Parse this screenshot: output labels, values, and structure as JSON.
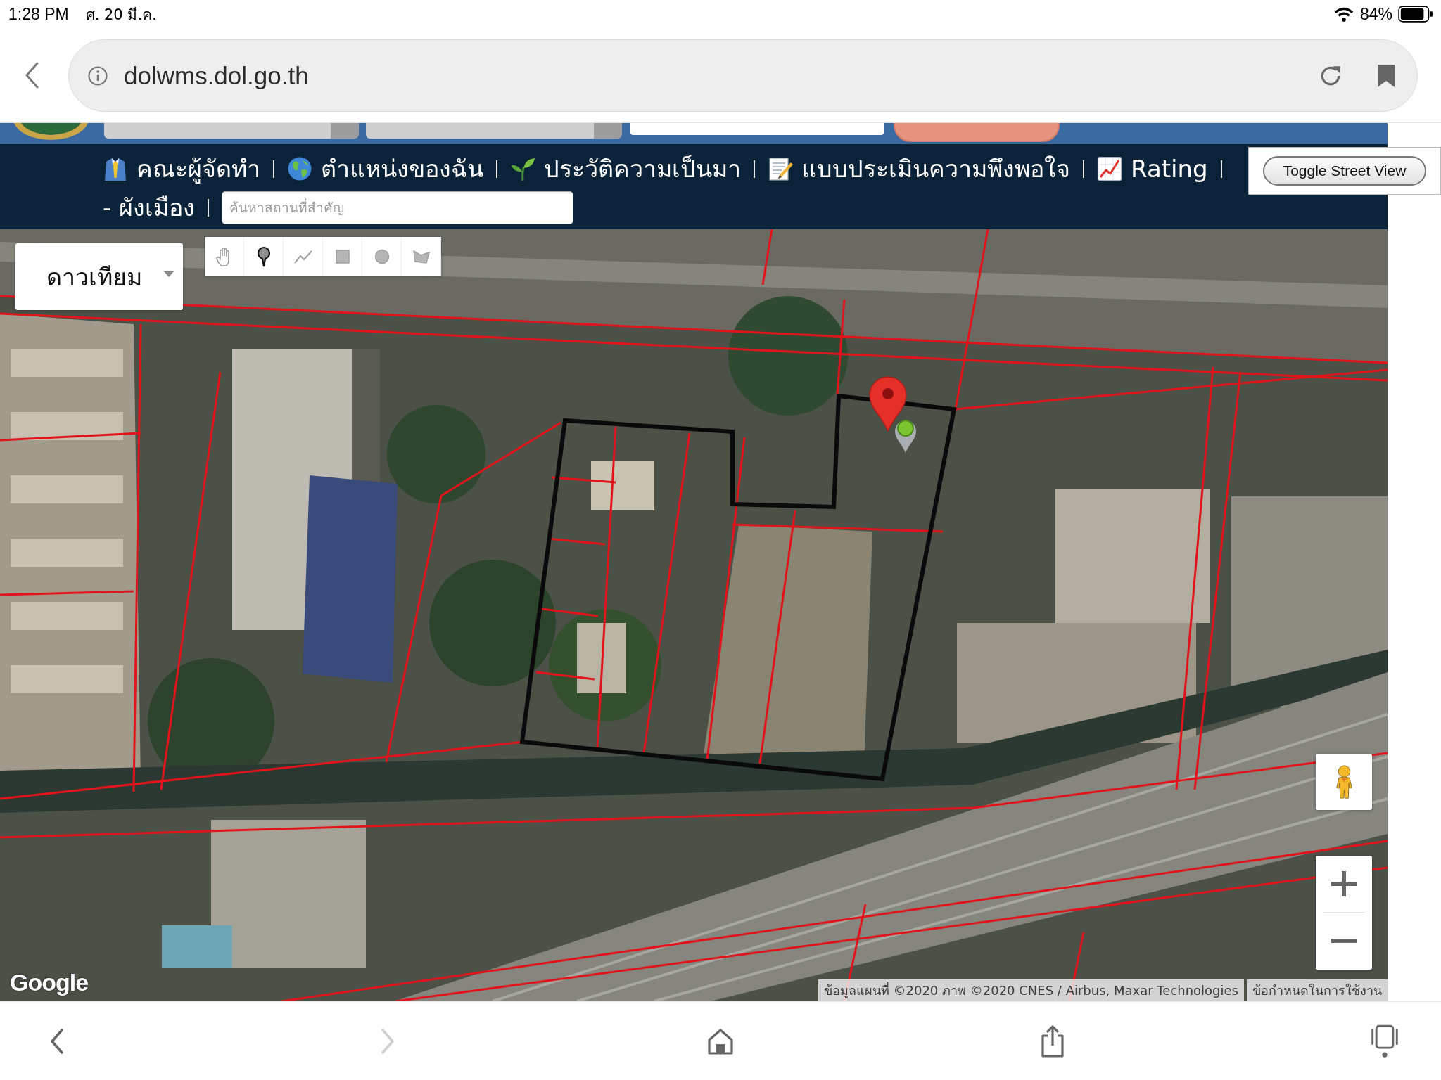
{
  "status_bar": {
    "time": "1:28 PM",
    "date": "ศ. 20 มี.ค.",
    "battery": "84%"
  },
  "browser": {
    "url": "dolwms.dol.go.th",
    "back": {
      "disabled": false
    },
    "forward": {
      "disabled": true
    }
  },
  "nav": {
    "rows": [
      [
        "คณะผู้จัดทำ",
        "ตำแหน่งของฉัน",
        "ประวัติความเป็นมา",
        "แบบประเมินความพึงพอใจ",
        "Rating"
      ],
      [
        "- ผังเมือง"
      ]
    ],
    "search": {
      "placeholder": "ค้นหาสถานที่สำคัญ"
    },
    "toggle_button": "Toggle Street View"
  },
  "map": {
    "map_type": "ดาวเทียม",
    "logo": "Google",
    "attribution": "ข้อมูลแผนที่ ©2020 ภาพ ©2020 CNES / Airbus, Maxar Technologies",
    "terms_link": "ข้อกำหนดในการใช้งาน"
  }
}
